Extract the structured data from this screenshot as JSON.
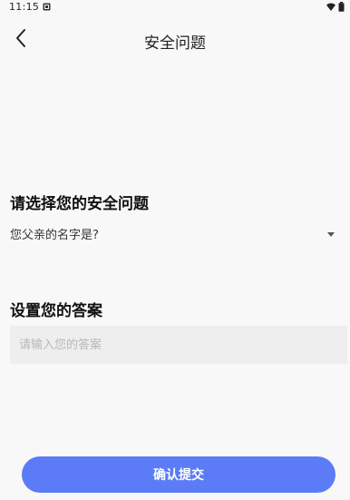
{
  "status_bar": {
    "time": "11:15",
    "icons": [
      "notification-icon",
      "wifi-icon",
      "battery-icon"
    ]
  },
  "app_bar": {
    "title": "安全问题",
    "back_icon": "back-chevron-icon"
  },
  "security_question": {
    "label": "请选择您的安全问题",
    "selected": "您父亲的名字是?",
    "dropdown_icon": "caret-down-icon"
  },
  "answer": {
    "label": "设置您的答案",
    "value": "",
    "placeholder": "请输入您的答案"
  },
  "submit": {
    "label": "确认提交",
    "color": "#5b7cf6"
  },
  "colors": {
    "background": "#f8f8f8",
    "input_background": "#eeeeee",
    "accent": "#5b7cf6"
  }
}
